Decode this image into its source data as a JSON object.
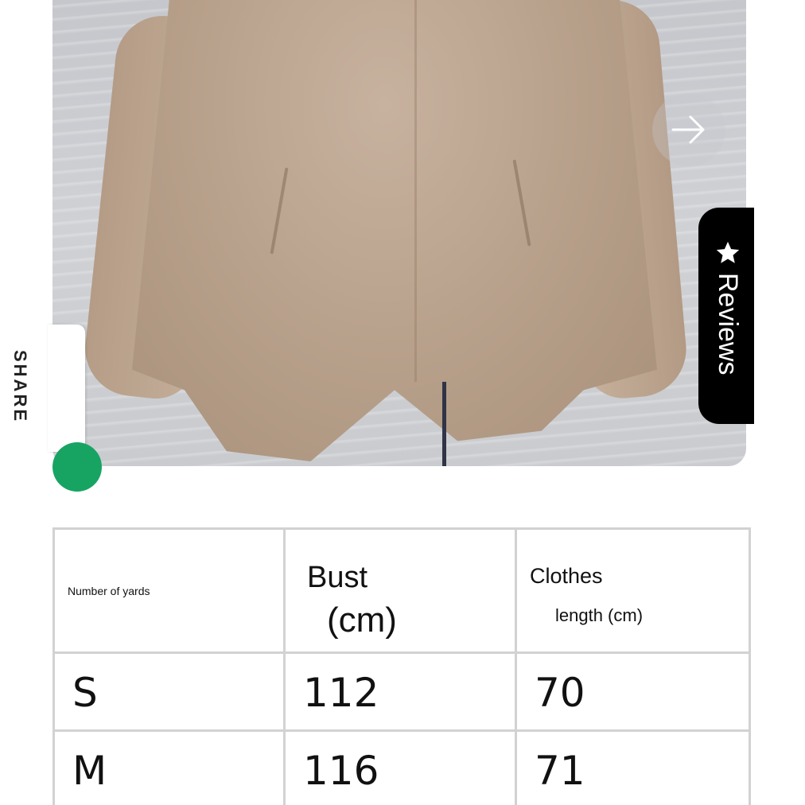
{
  "gallery": {
    "next_icon": "arrow-right-icon",
    "share_label": "SHARE",
    "share_icon": "share-icon",
    "reviews_label": "Reviews",
    "reviews_icon": "star-icon"
  },
  "size_table": {
    "headers": {
      "yards": "Number of yards",
      "bust_line1": "Bust",
      "bust_line2": "(cm)",
      "length_line1": "Clothes",
      "length_line2": "length (cm)"
    },
    "rows": [
      {
        "size": "S",
        "bust": "112",
        "length": "70"
      },
      {
        "size": "M",
        "bust": "116",
        "length": "71"
      }
    ]
  },
  "colors": {
    "reviews_bg": "#000000",
    "share_accent": "#17a463",
    "table_border": "#d2d2d2"
  }
}
